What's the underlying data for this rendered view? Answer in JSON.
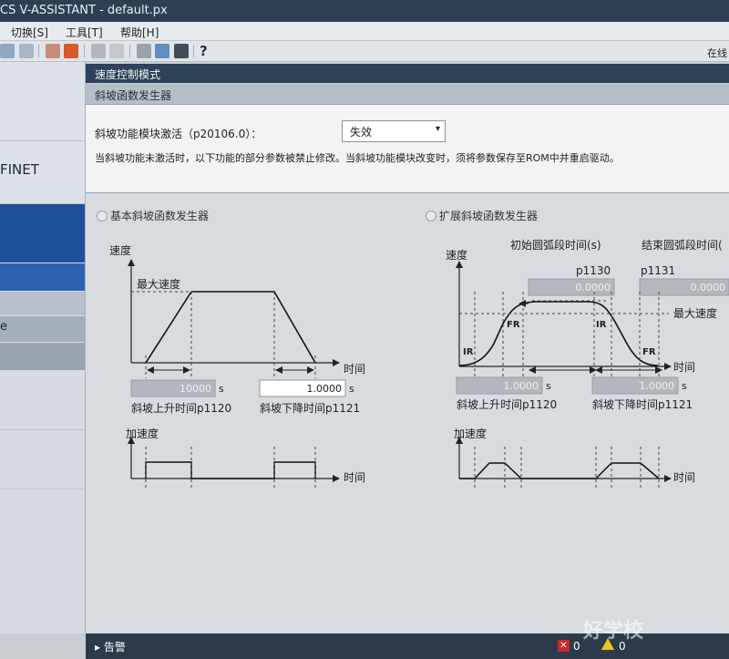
{
  "app": {
    "title": "CS V-ASSISTANT - default.px"
  },
  "menu": {
    "items": [
      "切换[S]",
      "工具[T]",
      "帮助[H]"
    ]
  },
  "toolbar": {
    "help_glyph": "?",
    "right_text": "在线"
  },
  "sidebar": {
    "text1": "FINET",
    "text2": "e"
  },
  "headers": {
    "mode": "速度控制模式",
    "section": "斜坡函数发生器"
  },
  "param": {
    "label": "斜坡功能模块激活（p20106.0）：",
    "dropdown_value": "失效",
    "note": "当斜坡功能未激活时，以下功能的部分参数被禁止修改。当斜坡功能模块改变时，须将参数保存至ROM中并重启驱动。"
  },
  "basic": {
    "label": "基本斜坡函数发生器",
    "speed_axis": "速度",
    "max_speed": "最大速度",
    "time_axis": "时间",
    "accel_axis": "加速度",
    "up_value": "10000",
    "down_value": "1.0000",
    "unit": "s",
    "up_label": "斜坡上升时间p1120",
    "down_label": "斜坡下降时间p1121"
  },
  "extended": {
    "label": "扩展斜坡函数发生器",
    "speed_axis": "速度",
    "max_speed": "最大速度",
    "time_axis": "时间",
    "accel_axis": "加速度",
    "start_round_label": "初始圆弧段时间(s)",
    "end_round_label": "结束圆弧段时间(",
    "p1130": "p1130",
    "p1131": "p1131",
    "p1130_value": "0.0000",
    "p1131_value": "0.0000",
    "up_value": "1.0000",
    "down_value": "1.0000",
    "unit": "s",
    "ir": "IR",
    "fr": "FR",
    "up_label": "斜坡上升时间p1120",
    "down_label": "斜坡下降时间p1121"
  },
  "status": {
    "label": "告警",
    "error_count": "0",
    "warning_count": "0"
  },
  "watermark": "好学校"
}
